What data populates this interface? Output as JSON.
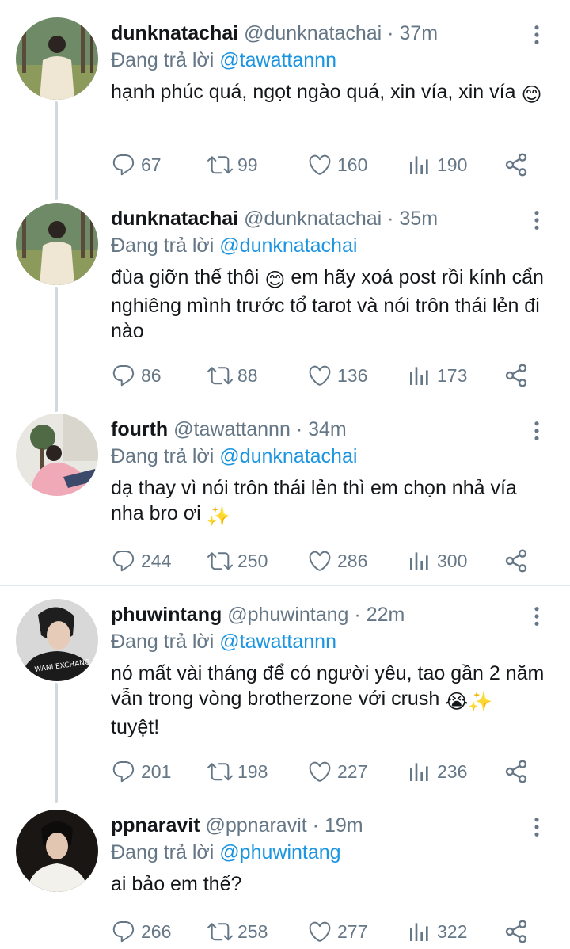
{
  "tweets": [
    {
      "name": "dunknatachai",
      "handle": "@dunknatachai",
      "dot": "·",
      "time": "37m",
      "reply_prefix": "Đang trả lời",
      "reply_to": "@tawattannn",
      "text": "hạnh phúc quá, ngọt ngào quá, xin vía, xin vía",
      "emoji_end": "😊",
      "replies": "67",
      "retweets": "99",
      "likes": "160",
      "views": "190"
    },
    {
      "name": "dunknatachai",
      "handle": "@dunknatachai",
      "dot": "·",
      "time": "35m",
      "reply_prefix": "Đang trả lời",
      "reply_to": "@dunknatachai",
      "text_a": "đùa giỡn thế thôi",
      "emoji_mid": "😊",
      "text_b": "em hãy xoá post rồi kính cẩn nghiêng mình trước tổ tarot và nói trôn thái lẻn đi nào",
      "replies": "86",
      "retweets": "88",
      "likes": "136",
      "views": "173"
    },
    {
      "name": "fourth",
      "handle": "@tawattannn",
      "dot": "·",
      "time": "34m",
      "reply_prefix": "Đang trả lời",
      "reply_to": "@dunknatachai",
      "text": "dạ thay vì nói trôn thái lẻn thì em chọn nhả vía nha bro ơi",
      "emoji_end": "✨",
      "replies": "244",
      "retweets": "250",
      "likes": "286",
      "views": "300"
    },
    {
      "name": "phuwintang",
      "handle": "@phuwintang",
      "dot": "·",
      "time": "22m",
      "reply_prefix": "Đang trả lời",
      "reply_to": "@tawattannn",
      "text": "nó mất vài tháng để có người yêu, tao gần 2 năm vẫn trong vòng brotherzone với crush",
      "emoji_a": "😭",
      "emoji_b": "✨",
      "text_end": "tuyệt!",
      "replies": "201",
      "retweets": "198",
      "likes": "227",
      "views": "236"
    },
    {
      "name": "ppnaravit",
      "handle": "@ppnaravit",
      "dot": "·",
      "time": "19m",
      "reply_prefix": "Đang trả lời",
      "reply_to": "@phuwintang",
      "text": "ai bảo em thế?",
      "replies": "266",
      "retweets": "258",
      "likes": "277",
      "views": "322"
    }
  ],
  "colors": {
    "accent": "#1b95e0",
    "muted": "#657786",
    "thread_line": "#cfd9de",
    "separator": "#e1e8ed"
  },
  "icons": [
    "reply-icon",
    "retweet-icon",
    "like-icon",
    "views-icon",
    "share-icon",
    "more-options-icon"
  ]
}
